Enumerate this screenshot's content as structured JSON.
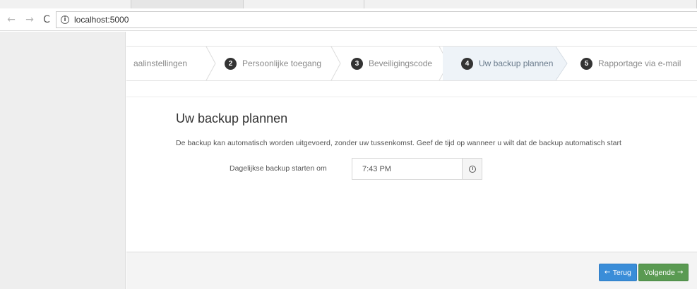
{
  "browser": {
    "url": "localhost:5000",
    "back_icon": "arrow-left-icon",
    "forward_icon": "arrow-right-icon",
    "reload_icon": "reload-icon",
    "info_icon": "info-icon"
  },
  "wizard": {
    "steps": [
      {
        "number": "",
        "label": "aalinstellingen",
        "active": false
      },
      {
        "number": "2",
        "label": "Persoonlijke toegang",
        "active": false
      },
      {
        "number": "3",
        "label": "Beveiligingscode",
        "active": false
      },
      {
        "number": "4",
        "label": "Uw backup plannen",
        "active": true
      },
      {
        "number": "5",
        "label": "Rapportage via e-mail",
        "active": false
      }
    ],
    "title": "Uw backup plannen",
    "description": "De backup kan automatisch worden uitgevoerd, zonder uw tussenkomst. Geef de tijd op wanneer u wilt dat de backup automatisch start",
    "field_label": "Dagelijkse backup starten om",
    "time_value": "7:43 PM",
    "clock_icon": "clock-icon",
    "back_button": "Terug",
    "next_button": "Volgende",
    "colors": {
      "back": "#3a8dd8",
      "next": "#5a9a52",
      "active_step": "#eef3f8"
    }
  }
}
